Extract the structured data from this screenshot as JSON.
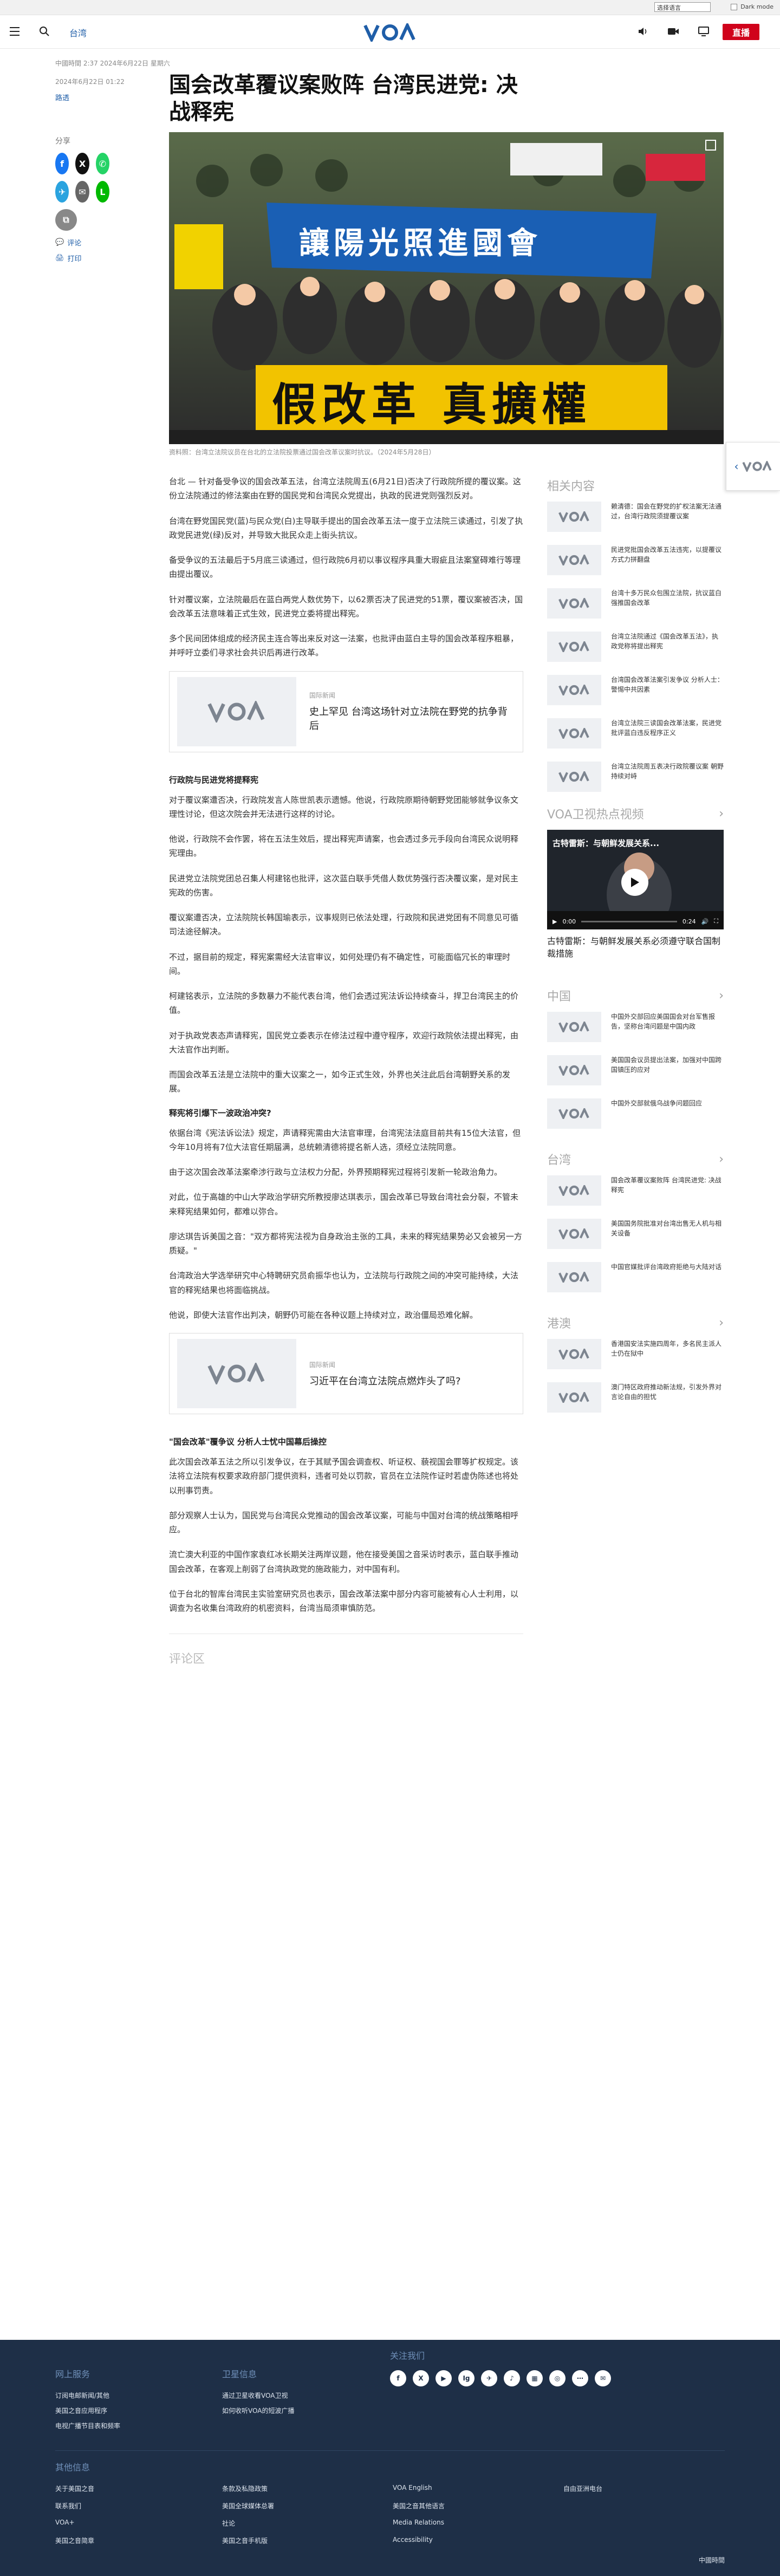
{
  "topbar": {
    "language_select": "选择语言",
    "mode_label": "Dark mode"
  },
  "header": {
    "section": "台湾",
    "live_label": "直播"
  },
  "article": {
    "byline": "中國時間 2:37 2024年6月22日 星期六",
    "date": "2024年6月22日 01:22",
    "source": "路透",
    "title": "国会改革覆议案败阵 台湾民进党: 决战释宪",
    "caption": "资料照：台湾立法院议员在台北的立法院投票通过国会改革议案时抗议。（2024年5月28日）",
    "banner_text_1": "讓陽光照進國會",
    "banner_text_2": "假改革 真擴權",
    "paragraphs": [
      "台北 — 针对备受争议的国会改革五法，台湾立法院周五(6月21日)否决了行政院所提的覆议案。这份立法院通过的修法案由在野的国民党和台湾民众党提出，执政的民进党则强烈反对。",
      "台湾在野党国民党(蓝)与民众党(白)主导联手提出的国会改革五法一度于立法院三读通过，引发了执政党民进党(绿)反对，并导致大批民众走上街头抗议。",
      "备受争议的五法最后于5月底三读通过，但行政院6月初以事议程序具重大瑕疵且法案窒碍难行等理由提出覆议。",
      "针对覆议案，立法院最后在蓝白两党人数优势下，以62票否决了民进党的51票，覆议案被否决，国会改革五法意味着正式生效，民进党立委将提出释宪。",
      "多个民间团体组成的经济民主连合等出来反对这一法案，也批评由蓝白主导的国会改革程序粗暴，并呼吁立委们寻求社会共识后再进行改革。",
      "对于覆议案遭否决，行政院发言人陈世凯表示遗憾。他说，行政院原期待朝野党团能够就争议条文理性讨论，但这次院会并无法进行这样的讨论。",
      "他说，行政院不会作罢，将在五法生效后，提出释宪声请案，也会透过多元手段向台湾民众说明释宪理由。",
      "民进党立法院党团总召集人柯建铭也批评，这次蓝白联手凭借人数优势强行否决覆议案，是对民主宪政的伤害。",
      "覆议案遭否决，立法院院长韩国瑜表示，议事规则已依法处理，行政院和民进党团有不同意见可循司法途径解决。",
      "不过，据目前的规定，释宪案需经大法官审议，如何处理仍有不确定性，可能面临冗长的审理时间。",
      "柯建铭表示，立法院的多数暴力不能代表台湾，他们会透过宪法诉讼持续奋斗，捍卫台湾民主的价值。",
      "对于执政党表态声请释宪，国民党立委表示在修法过程中遵守程序，欢迎行政院依法提出释宪，由大法官作出判断。",
      "而国会改革五法是立法院中的重大议案之一，如今正式生效，外界也关注此后台湾朝野关系的发展。"
    ],
    "subhead_1": "行政院与民进党将提释宪",
    "subhead_2": "释宪将引爆下一波政治冲突?",
    "subhead_3": "\"国会改革\"覆争议 分析人士忧中国幕后操控",
    "paragraphs_2": [
      "依据台湾《宪法诉讼法》规定，声请释宪需由大法官审理，台湾宪法法庭目前共有15位大法官，但今年10月将有7位大法官任期届满，总统赖清德将提名新人选，须经立法院同意。",
      "由于这次国会改革法案牵涉行政与立法权力分配，外界预期释宪过程将引发新一轮政治角力。",
      "对此，位于高雄的中山大学政治学研究所教授廖达琪表示，国会改革已导致台湾社会分裂，不管未来释宪结果如何，都难以弥合。",
      "廖达琪告诉美国之音：\"双方都将宪法视为自身政治主张的工具，未来的释宪结果势必又会被另一方质疑。\"",
      "台湾政治大学选举研究中心特聘研究员俞振华也认为，立法院与行政院之间的冲突可能持续，大法官的释宪结果也将面临挑战。",
      "他说，即使大法官作出判决，朝野仍可能在各种议题上持续对立，政治僵局恐难化解。"
    ],
    "related_1": {
      "kicker": "国际新闻",
      "title": "史上罕见 台湾这场针对立法院在野党的抗争背后"
    },
    "related_2": {
      "kicker": "国际新闻",
      "title": "习近平在台湾立法院点燃炸头了吗?"
    },
    "paragraphs_3": [
      "此次国会改革五法之所以引发争议，在于其赋予国会调查权、听证权、藐视国会罪等扩权规定。该法将立法院有权要求政府部门提供资料，违者可处以罚款，官员在立法院作证时若虚伪陈述也将处以刑事罚责。",
      "部分观察人士认为，国民党与台湾民众党推动的国会改革议案，可能与中国对台湾的统战策略相呼应。",
      "流亡澳大利亚的中国作家袁红冰长期关注两岸议题，他在接受美国之音采访时表示，蓝白联手推动国会改革，在客观上削弱了台湾执政党的施政能力，对中国有利。",
      "位于台北的智库台湾民主实验室研究员也表示，国会改革法案中部分内容可能被有心人士利用，以调查为名收集台湾政府的机密资料，台湾当局须审慎防范。"
    ],
    "comments_label": "评论区"
  },
  "share": {
    "label": "分享",
    "comment": "评论",
    "print": "打印"
  },
  "rail": {
    "related_heading": "相关内容",
    "related": [
      "赖清德：国会在野党的扩权法案无法通过，台湾行政院须提覆议案",
      "民进党批国会改革五法违宪，以提覆议方式力拼翻盘",
      "台湾十多万民众包围立法院，抗议蓝白强推国会改革",
      "台湾立法院通过《国会改革五法》，执政党称将提出释宪",
      "台湾国会改革法案引发争议 分析人士：警惕中共因素",
      "台湾立法院三读国会改革法案，民进党批评蓝白违反程序正义",
      "台湾立法院周五表决行政院覆议案 朝野持续对峙"
    ],
    "video_heading": "VOA卫视热点视频",
    "video_title": "古特雷斯：与朝鲜发展关系...",
    "video_time": "0:00",
    "video_duration": "0:24",
    "video_caption": "古特雷斯：与朝鲜发展关系必须遵守联合国制裁措施",
    "china_heading": "中国",
    "china": [
      "中国外交部回应美国国会对台军售报告，坚称台湾问题是中国内政",
      "美国国会议员提出法案，加强对中国跨国镇压的应对",
      "中国外交部就俄乌战争问题回应"
    ],
    "taiwan_heading": "台湾",
    "taiwan": [
      "国会改革覆议案败阵 台湾民进党: 决战释宪",
      "美国国务院批准对台湾出售无人机与相关设备",
      "中国官媒批评台湾政府拒绝与大陆对话"
    ],
    "hk_heading": "港澳",
    "hk": [
      "香港国安法实施四周年，多名民主派人士仍在狱中",
      "澳门特区政府推动新法规，引发外界对言论自由的担忧"
    ]
  },
  "footer": {
    "online": "网上服务",
    "online_links": [
      "订阅电邮新闻/其他",
      "美国之音应用程序",
      "电视广播节目表和频率"
    ],
    "sat": "卫星信息",
    "sat_links": [
      "通过卫星收看VOA卫视",
      "如何收听VOA的短波广播"
    ],
    "follow": "关注我们",
    "social": [
      "f",
      "X",
      "▶",
      "Ig",
      "✈",
      "♪",
      "▦",
      "◎",
      "⋯",
      "✉"
    ],
    "other": "其他信息",
    "cols": [
      [
        "关于美国之音",
        "联系我们",
        "VOA+",
        "美国之音简章"
      ],
      [
        "条款及私隐政策",
        "美国全球媒体总署",
        "社论",
        "美国之音手机版"
      ],
      [
        "VOA English",
        "美国之音其他语言",
        "Media Relations",
        "Accessibility"
      ],
      [
        "自由亚洲电台"
      ]
    ],
    "publisher": "中國時間"
  },
  "colors": {
    "brand": "#1f5ea8",
    "live": "#d0021b",
    "footer_bg": "#1e2f47"
  }
}
